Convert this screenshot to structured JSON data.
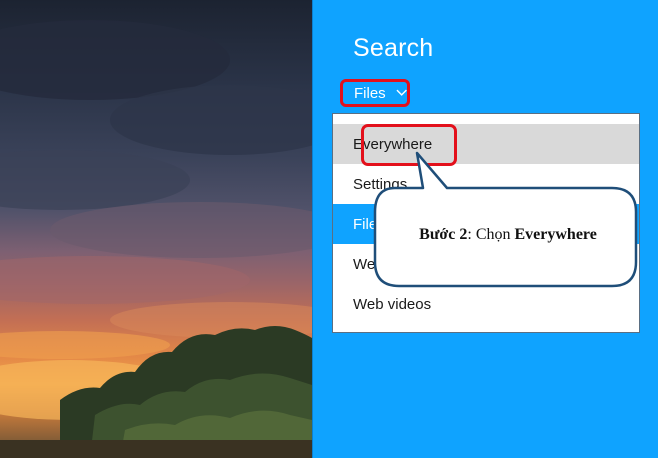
{
  "search": {
    "title": "Search",
    "scope_label": "Files"
  },
  "dropdown": {
    "items": [
      {
        "label": "Everywhere",
        "state": "selected"
      },
      {
        "label": "Settings",
        "state": "normal"
      },
      {
        "label": "Files",
        "state": "highlighted"
      },
      {
        "label": "Web images",
        "state": "normal"
      },
      {
        "label": "Web videos",
        "state": "normal"
      }
    ]
  },
  "callout": {
    "step": "Bước 2",
    "separator": ": ",
    "action": "Chọn ",
    "target": "Everywhere"
  },
  "colors": {
    "pane_bg": "#0fa3ff",
    "highlight_red": "#e3101b",
    "callout_border": "#1f4e79"
  }
}
